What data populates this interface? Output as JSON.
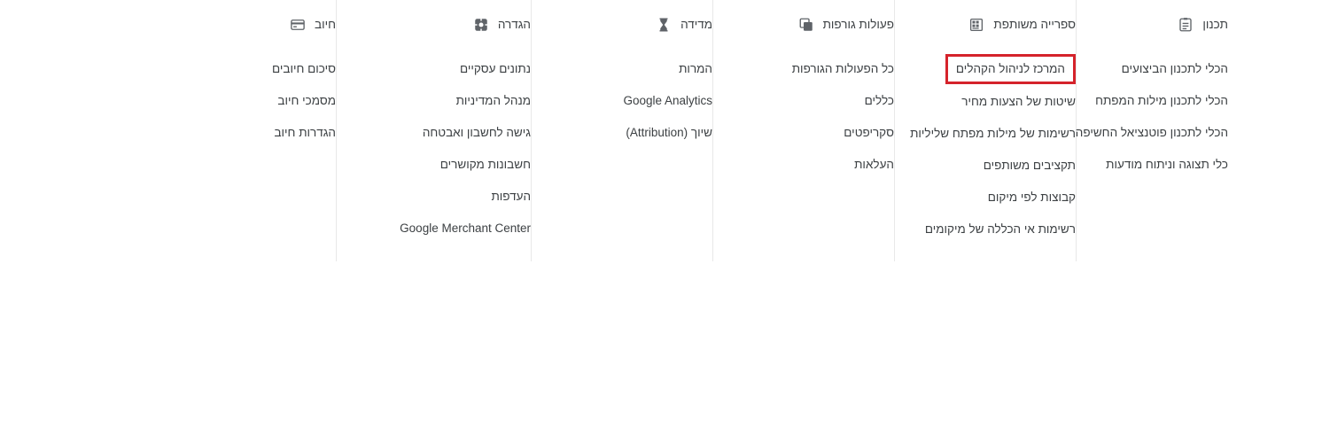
{
  "panel": {
    "accent_highlight_color": "#d5232b",
    "text_color": "#3c4043",
    "divider_color": "#e8e8e8",
    "background": "#ffffff"
  },
  "columns": [
    {
      "id": "planning",
      "icon": "clipboard-lines-icon",
      "label": "תכנון",
      "items": [
        {
          "label": "הכלי לתכנון הביצועים",
          "highlighted": false
        },
        {
          "label": "הכלי לתכנון מילות המפתח",
          "highlighted": false
        },
        {
          "label": "הכלי לתכנון פוטנציאל החשיפה",
          "highlighted": false
        },
        {
          "label": "כלי תצוגה וניתוח מודעות",
          "highlighted": false
        }
      ]
    },
    {
      "id": "shared-library",
      "icon": "library-grid-icon",
      "label": "ספרייה משותפת",
      "items": [
        {
          "label": "המרכז לניהול הקהלים",
          "highlighted": true
        },
        {
          "label": "שיטות של הצעות מחיר",
          "highlighted": false
        },
        {
          "label": "רשימות של מילות מפתח שליליות",
          "highlighted": false
        },
        {
          "label": "תקציבים משותפים",
          "highlighted": false
        },
        {
          "label": "קבוצות לפי מיקום",
          "highlighted": false
        },
        {
          "label": "רשימות אי הכללה של מיקומים",
          "highlighted": false
        }
      ]
    },
    {
      "id": "bulk-actions",
      "icon": "copy-layers-icon",
      "label": "פעולות גורפות",
      "items": [
        {
          "label": "כל הפעולות הגורפות",
          "highlighted": false
        },
        {
          "label": "כללים",
          "highlighted": false
        },
        {
          "label": "סקריפטים",
          "highlighted": false
        },
        {
          "label": "העלאות",
          "highlighted": false
        }
      ]
    },
    {
      "id": "measurement",
      "icon": "hourglass-icon",
      "label": "מדידה",
      "items": [
        {
          "label": "המרות",
          "highlighted": false
        },
        {
          "label": "Google Analytics",
          "highlighted": false
        },
        {
          "label": "שיוך (Attribution)",
          "highlighted": false
        }
      ]
    },
    {
      "id": "setup",
      "icon": "gear-icon",
      "label": "הגדרה",
      "items": [
        {
          "label": "נתונים עסקיים",
          "highlighted": false
        },
        {
          "label": "מנהל המדיניות",
          "highlighted": false
        },
        {
          "label": "גישה לחשבון ואבטחה",
          "highlighted": false
        },
        {
          "label": "חשבונות מקושרים",
          "highlighted": false
        },
        {
          "label": "העדפות",
          "highlighted": false
        },
        {
          "label": "Google Merchant Center",
          "highlighted": false
        }
      ]
    },
    {
      "id": "billing",
      "icon": "credit-card-icon",
      "label": "חיוב",
      "items": [
        {
          "label": "סיכום חיובים",
          "highlighted": false
        },
        {
          "label": "מסמכי חיוב",
          "highlighted": false
        },
        {
          "label": "הגדרות חיוב",
          "highlighted": false
        }
      ]
    }
  ]
}
